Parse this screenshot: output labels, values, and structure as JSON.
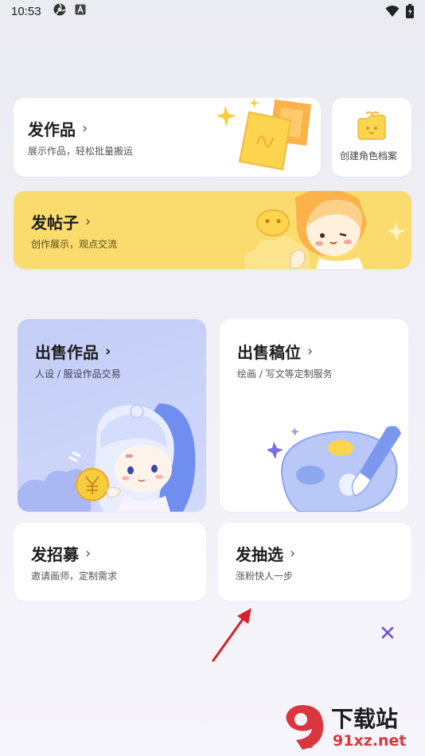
{
  "status_bar": {
    "time": "10:53"
  },
  "cards": {
    "publish_work": {
      "title": "发作品",
      "subtitle": "展示作品，轻松批量搬运"
    },
    "create_character": {
      "label": "创建角色档案"
    },
    "publish_post": {
      "title": "发帖子",
      "subtitle": "创作展示，观点交流"
    },
    "sell_work": {
      "title": "出售作品",
      "subtitle": "人设 / 服设作品交易"
    },
    "sell_slot": {
      "title": "出售稿位",
      "subtitle": "绘画 / 写文等定制服务"
    },
    "recruit": {
      "title": "发招募",
      "subtitle": "邀请画师，定制需求"
    },
    "lottery": {
      "title": "发抽选",
      "subtitle": "涨粉快人一步"
    }
  },
  "chevron": "›",
  "watermark": {
    "brand": "下载站",
    "site": "91xz.net",
    "logo_text": "9"
  },
  "colors": {
    "accent_yellow": "#f9d96a",
    "accent_blue": "#c9d4f7",
    "close_purple": "#6b4fd8",
    "watermark_red": "#d9363e"
  }
}
